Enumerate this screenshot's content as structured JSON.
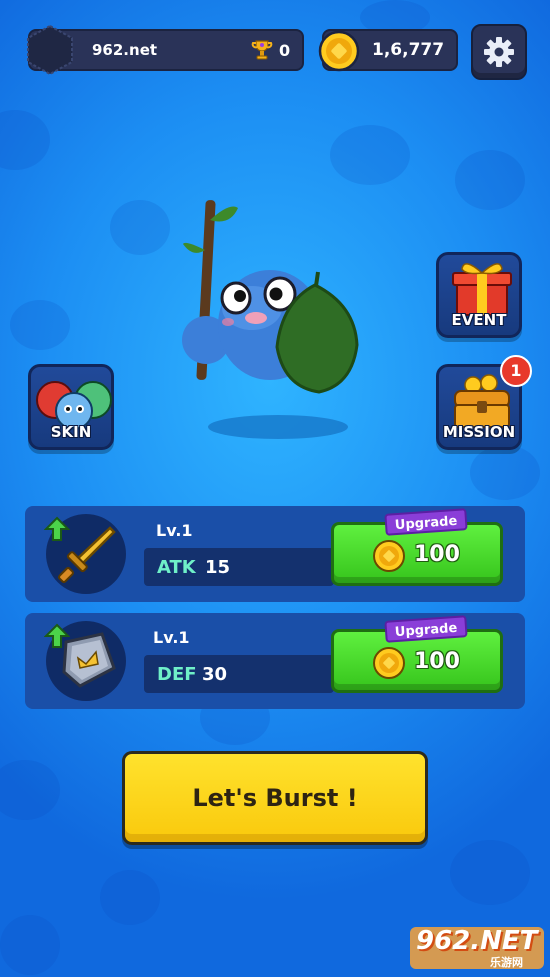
{
  "header": {
    "player_name": "962.net",
    "trophy_count": "0",
    "coin_total": "1,6,777"
  },
  "side_buttons": {
    "skin_label": "SKIN",
    "event_label": "EVENT",
    "mission_label": "MISSION",
    "mission_badge": "1"
  },
  "upgrades": [
    {
      "level": "Lv.1",
      "stat": "ATK",
      "value": "15",
      "tag": "Upgrade",
      "cost": "100",
      "icon": "sword-icon"
    },
    {
      "level": "Lv.1",
      "stat": "DEF",
      "value": "30",
      "tag": "Upgrade",
      "cost": "100",
      "icon": "shield-icon"
    }
  ],
  "play_button": {
    "label": "Let's Burst !"
  },
  "watermark": {
    "main": "962.NET",
    "sub": "乐游网"
  },
  "colors": {
    "background": "#1c8ef3",
    "panel": "#1a4fa8",
    "upgrade_green": "#36c41c",
    "play_yellow": "#f9c90c",
    "stat_text": "#6ff0c8",
    "badge_red": "#e8392b"
  }
}
